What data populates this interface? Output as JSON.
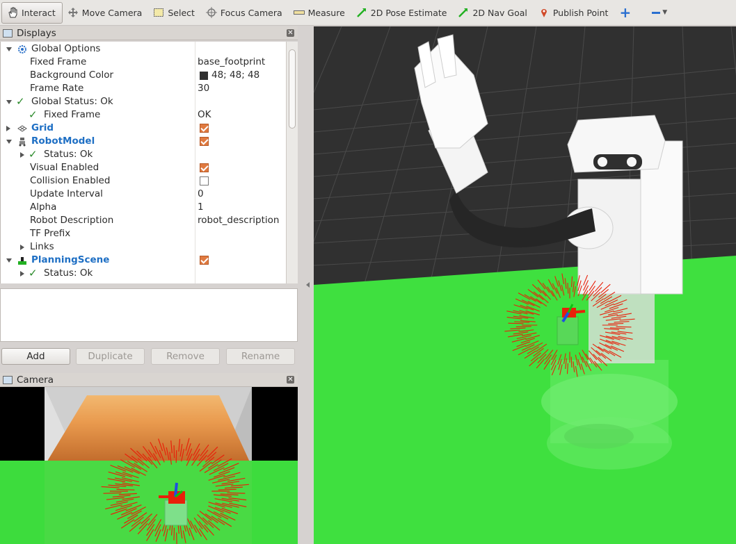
{
  "toolbar": {
    "items": [
      {
        "label": "Interact",
        "icon": "hand-icon",
        "active": true
      },
      {
        "label": "Move Camera",
        "icon": "move-camera-icon"
      },
      {
        "label": "Select",
        "icon": "select-icon"
      },
      {
        "label": "Focus Camera",
        "icon": "focus-camera-icon"
      },
      {
        "label": "Measure",
        "icon": "measure-icon"
      },
      {
        "label": "2D Pose Estimate",
        "icon": "green-arrow-icon"
      },
      {
        "label": "2D Nav Goal",
        "icon": "green-arrow-icon"
      },
      {
        "label": "Publish Point",
        "icon": "map-pin-icon"
      }
    ],
    "add_tool_icon": "plus-icon",
    "remove_tool_icon": "minus-icon"
  },
  "displays_panel": {
    "title": "Displays",
    "rows": [
      {
        "label": "Global Options",
        "value": "",
        "indent": 0,
        "expand": "down",
        "icon": "gear-icon",
        "style": "normal"
      },
      {
        "label": "Fixed Frame",
        "value": "base_footprint",
        "indent": 1
      },
      {
        "label": "Background Color",
        "value": "48; 48; 48",
        "indent": 1,
        "swatch": "#303030"
      },
      {
        "label": "Frame Rate",
        "value": "30",
        "indent": 1
      },
      {
        "label": "Global Status: Ok",
        "value": "",
        "indent": 0,
        "expand": "down",
        "check": true
      },
      {
        "label": "Fixed Frame",
        "value": "OK",
        "indent": 1,
        "check": true
      },
      {
        "label": "Grid",
        "value": "",
        "indent": 0,
        "expand": "right",
        "icon": "grid-icon",
        "style": "blue",
        "checkbox": true
      },
      {
        "label": "RobotModel",
        "value": "",
        "indent": 0,
        "expand": "down",
        "icon": "robot-icon",
        "style": "blue",
        "checkbox": true
      },
      {
        "label": "Status: Ok",
        "value": "",
        "indent": 1,
        "expand": "right",
        "check": true
      },
      {
        "label": "Visual Enabled",
        "value": "",
        "indent": 1,
        "checkbox": true
      },
      {
        "label": "Collision Enabled",
        "value": "",
        "indent": 1,
        "checkbox": false
      },
      {
        "label": "Update Interval",
        "value": "0",
        "indent": 1
      },
      {
        "label": "Alpha",
        "value": "1",
        "indent": 1
      },
      {
        "label": "Robot Description",
        "value": "robot_description",
        "indent": 1
      },
      {
        "label": "TF Prefix",
        "value": "",
        "indent": 1
      },
      {
        "label": "Links",
        "value": "",
        "indent": 1,
        "expand": "right"
      },
      {
        "label": "PlanningScene",
        "value": "",
        "indent": 0,
        "expand": "down",
        "icon": "planning-scene-icon",
        "style": "blue",
        "checkbox": true
      },
      {
        "label": "Status: Ok",
        "value": "",
        "indent": 1,
        "expand": "right",
        "check": true
      }
    ],
    "buttons": [
      {
        "label": "Add",
        "enabled": true
      },
      {
        "label": "Duplicate",
        "enabled": false
      },
      {
        "label": "Remove",
        "enabled": false
      },
      {
        "label": "Rename",
        "enabled": false
      }
    ]
  },
  "camera_panel": {
    "title": "Camera"
  },
  "colors": {
    "accent_check": "#e07a40",
    "link_blue": "#1e6fc4",
    "scene_green": "#3fe03f",
    "marker_red": "#e8200a"
  }
}
